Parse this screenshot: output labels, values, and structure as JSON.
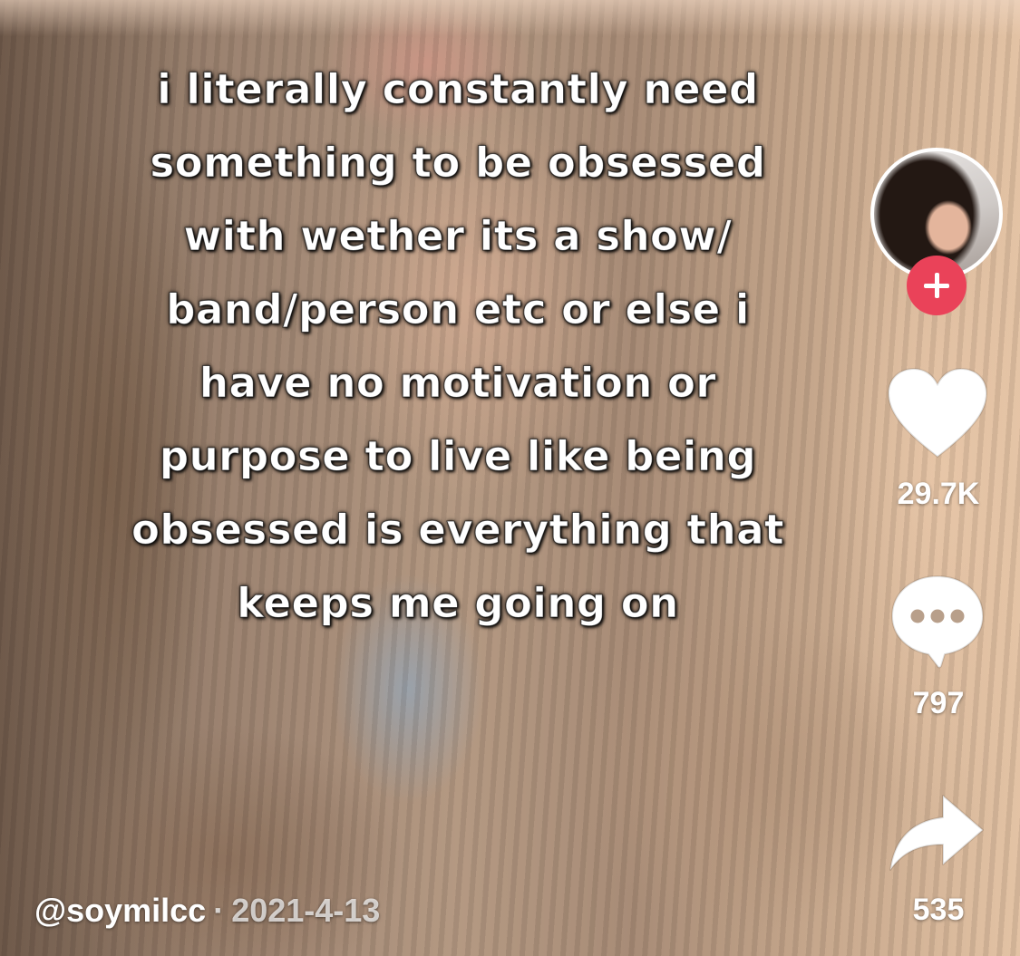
{
  "caption": {
    "lines": [
      "i literally constantly need",
      "something to be obsessed",
      "with wether its a show/",
      "band/person etc or else i",
      "have no motivation or",
      "purpose to live like being",
      "obsessed is everything that",
      "keeps me going on"
    ]
  },
  "actions": {
    "avatar_icon": "profile-avatar",
    "follow_icon": "plus-icon",
    "like_icon": "heart-icon",
    "like_count": "29.7K",
    "comment_icon": "comment-bubble-icon",
    "comment_count": "797",
    "share_icon": "share-arrow-icon",
    "share_count": "535"
  },
  "meta": {
    "username": "@soymilcc",
    "separator": "·",
    "date": "2021-4-13"
  },
  "colors": {
    "follow_badge": "#ea4259",
    "icon_white": "#ffffff"
  }
}
